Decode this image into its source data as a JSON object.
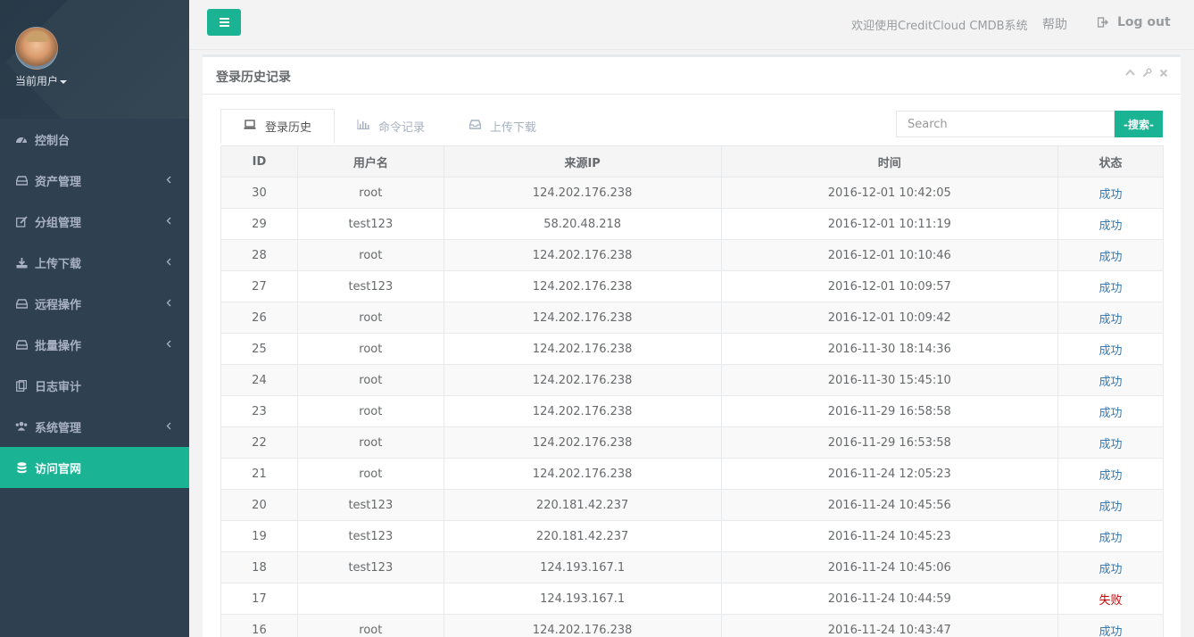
{
  "sidebar": {
    "user_label": "当前用户",
    "items": [
      {
        "label": "控制台",
        "icon": "dashboard-icon",
        "has_submenu": false
      },
      {
        "label": "资产管理",
        "icon": "hdd-icon",
        "has_submenu": true
      },
      {
        "label": "分组管理",
        "icon": "edit-icon",
        "has_submenu": true
      },
      {
        "label": "上传下载",
        "icon": "download-icon",
        "has_submenu": true
      },
      {
        "label": "远程操作",
        "icon": "hdd-icon",
        "has_submenu": true
      },
      {
        "label": "批量操作",
        "icon": "hdd-icon",
        "has_submenu": true
      },
      {
        "label": "日志审计",
        "icon": "clipboard-icon",
        "has_submenu": false
      },
      {
        "label": "系统管理",
        "icon": "users-icon",
        "has_submenu": true
      },
      {
        "label": "访问官网",
        "icon": "database-icon",
        "has_submenu": false,
        "active": true
      }
    ]
  },
  "header": {
    "welcome": "欢迎使用CreditCloud CMDB系统",
    "help": "帮助",
    "logout": "Log out"
  },
  "panel": {
    "title": "登录历史记录"
  },
  "tabs": [
    {
      "label": "登录历史",
      "icon": "laptop-icon",
      "active": true
    },
    {
      "label": "命令记录",
      "icon": "bar-chart-icon",
      "active": false
    },
    {
      "label": "上传下载",
      "icon": "inbox-icon",
      "active": false
    }
  ],
  "search": {
    "placeholder": "Search",
    "button": "-搜索-"
  },
  "table": {
    "headers": [
      "ID",
      "用户名",
      "来源IP",
      "时间",
      "状态"
    ],
    "rows": [
      {
        "id": "30",
        "user": "root",
        "ip": "124.202.176.238",
        "time": "2016-12-01 10:42:05",
        "status": "成功"
      },
      {
        "id": "29",
        "user": "test123",
        "ip": "58.20.48.218",
        "time": "2016-12-01 10:11:19",
        "status": "成功"
      },
      {
        "id": "28",
        "user": "root",
        "ip": "124.202.176.238",
        "time": "2016-12-01 10:10:46",
        "status": "成功"
      },
      {
        "id": "27",
        "user": "test123",
        "ip": "124.202.176.238",
        "time": "2016-12-01 10:09:57",
        "status": "成功"
      },
      {
        "id": "26",
        "user": "root",
        "ip": "124.202.176.238",
        "time": "2016-12-01 10:09:42",
        "status": "成功"
      },
      {
        "id": "25",
        "user": "root",
        "ip": "124.202.176.238",
        "time": "2016-11-30 18:14:36",
        "status": "成功"
      },
      {
        "id": "24",
        "user": "root",
        "ip": "124.202.176.238",
        "time": "2016-11-30 15:45:10",
        "status": "成功"
      },
      {
        "id": "23",
        "user": "root",
        "ip": "124.202.176.238",
        "time": "2016-11-29 16:58:58",
        "status": "成功"
      },
      {
        "id": "22",
        "user": "root",
        "ip": "124.202.176.238",
        "time": "2016-11-29 16:53:58",
        "status": "成功"
      },
      {
        "id": "21",
        "user": "root",
        "ip": "124.202.176.238",
        "time": "2016-11-24 12:05:23",
        "status": "成功"
      },
      {
        "id": "20",
        "user": "test123",
        "ip": "220.181.42.237",
        "time": "2016-11-24 10:45:56",
        "status": "成功"
      },
      {
        "id": "19",
        "user": "test123",
        "ip": "220.181.42.237",
        "time": "2016-11-24 10:45:23",
        "status": "成功"
      },
      {
        "id": "18",
        "user": "test123",
        "ip": "124.193.167.1",
        "time": "2016-11-24 10:45:06",
        "status": "成功"
      },
      {
        "id": "17",
        "user": "",
        "ip": "124.193.167.1",
        "time": "2016-11-24 10:44:59",
        "status": "失败"
      },
      {
        "id": "16",
        "user": "root",
        "ip": "124.202.176.238",
        "time": "2016-11-24 10:43:47",
        "status": "成功"
      }
    ]
  },
  "colors": {
    "accent": "#1ab394",
    "sidebar_bg": "#2f4050",
    "status_success": "#337ab7",
    "status_fail": "#cc0000"
  }
}
